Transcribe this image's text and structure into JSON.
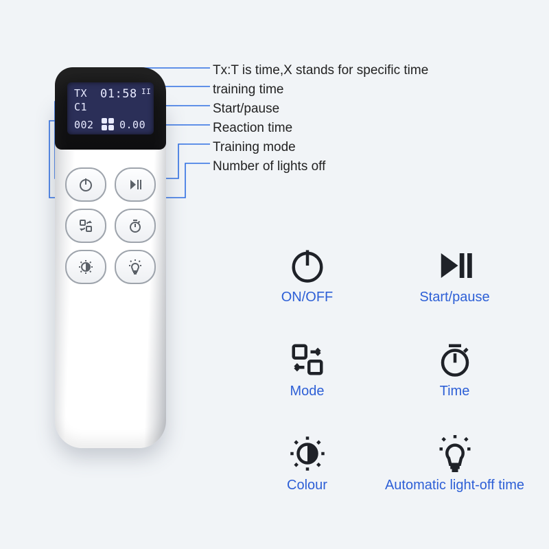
{
  "display": {
    "tx": "TX",
    "mode": "C1",
    "time": "01:58",
    "pause_glyph": "II",
    "count": "002",
    "reaction": "0.00"
  },
  "callouts": {
    "l1": "Tx:T is time,X stands for specific time",
    "l2": "training time",
    "l3": "Start/pause",
    "l4": "Reaction time",
    "l5": "Training mode",
    "l6": "Number of lights off"
  },
  "legend": {
    "onoff": "ON/OFF",
    "startpause": "Start/pause",
    "mode": "Mode",
    "time": "Time",
    "colour": "Colour",
    "auto": "Automatic light-off time"
  }
}
